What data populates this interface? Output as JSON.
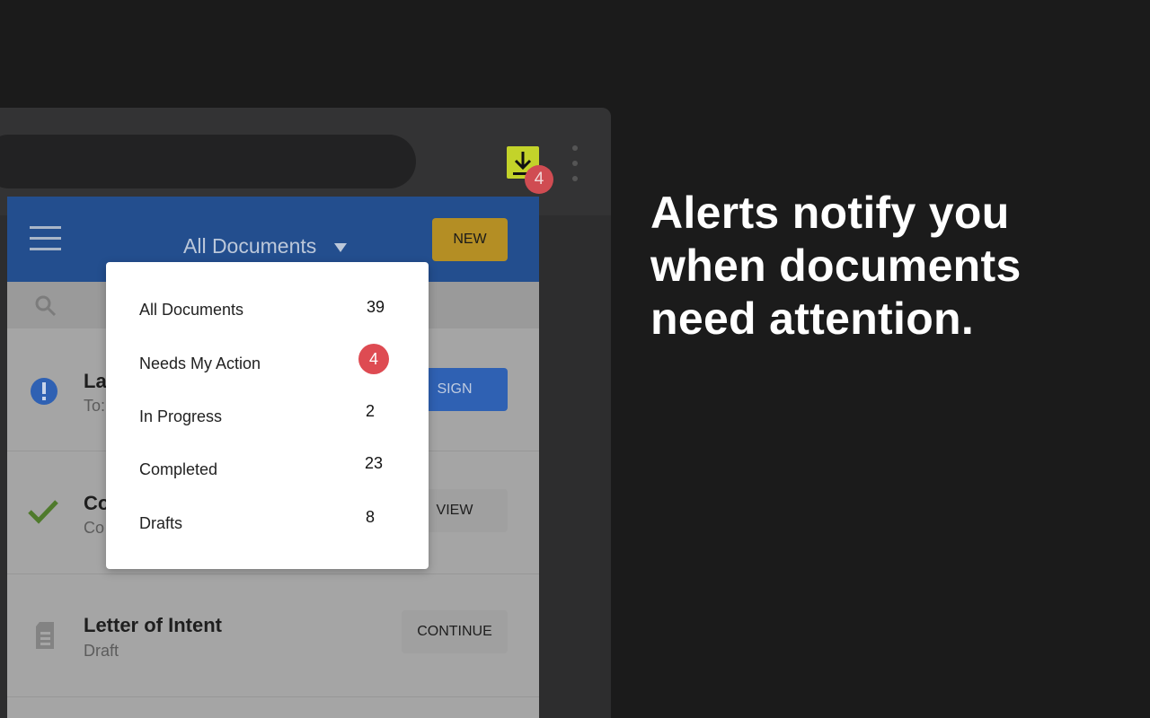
{
  "extension": {
    "icon": "download-arrow-icon",
    "badge_count": "4"
  },
  "popup": {
    "header": {
      "menu_icon": "hamburger-menu-icon",
      "title": "All Documents",
      "new_button": "NEW"
    },
    "search_icon": "search-icon",
    "documents": [
      {
        "title": "La",
        "subtitle": "To:",
        "icon": "alert-circle-icon",
        "action": "SIGN",
        "action_color": "#2f61b3"
      },
      {
        "title": "Co",
        "subtitle": "Co",
        "icon": "checkmark-icon",
        "action": "VIEW",
        "action_color": "#a0a0a0"
      },
      {
        "title": "Letter of Intent",
        "subtitle": "Draft",
        "icon": "document-icon",
        "action": "CONTINUE",
        "action_color": "#a0a0a0"
      }
    ]
  },
  "dropdown": {
    "items": [
      {
        "label": "All Documents",
        "count": "39"
      },
      {
        "label": "Needs My Action",
        "count": "4"
      },
      {
        "label": "In Progress",
        "count": "2"
      },
      {
        "label": "Completed",
        "count": "23"
      },
      {
        "label": "Drafts",
        "count": "8"
      }
    ]
  },
  "promo": {
    "line1": "Alerts notify you",
    "line2": "when documents",
    "line3": "need attention."
  },
  "colors": {
    "header_blue": "#234e8e",
    "new_button": "#b48e24",
    "sign_button": "#2f61b3",
    "badge_red": "#de4b52",
    "extension_yellow": "#c3d32a"
  }
}
